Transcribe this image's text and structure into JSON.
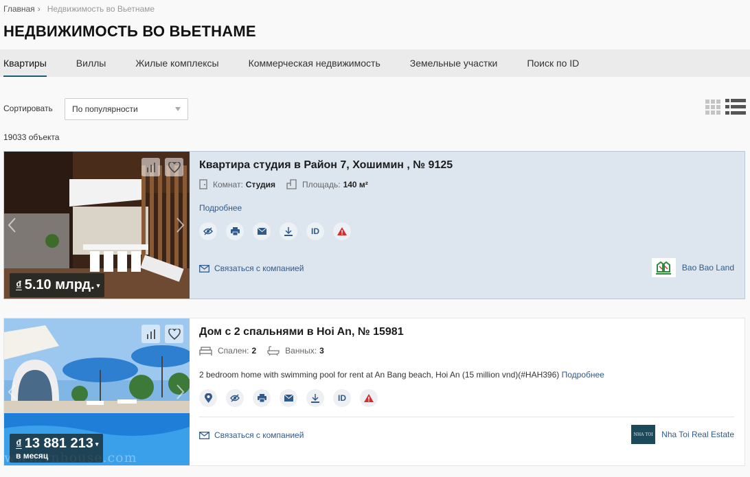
{
  "breadcrumb": {
    "home": "Главная",
    "separator": "›",
    "current": "Недвижимость во Вьетнаме"
  },
  "page_title": "НЕДВИЖИМОСТЬ ВО ВЬЕТНАМЕ",
  "tabs": [
    {
      "label": "Квартиры",
      "active": true
    },
    {
      "label": "Виллы"
    },
    {
      "label": "Жилые комплексы"
    },
    {
      "label": "Коммерческая недвижимость"
    },
    {
      "label": "Земельные участки"
    },
    {
      "label": "Поиск по ID"
    }
  ],
  "sort": {
    "label": "Сортировать",
    "value": "По популярности"
  },
  "results_count": "19033 объекта",
  "colors": {
    "link": "#2e5a8c",
    "highlight_bg": "#dde5ee",
    "alert": "#d32f2f",
    "tab_bar": "#ebebeb"
  },
  "listings": [
    {
      "title": "Квартира студия в Район 7, Хошимин , № 9125",
      "specs": [
        {
          "icon": "door-icon",
          "label": "Комнат:",
          "value": "Студия"
        },
        {
          "icon": "area-icon",
          "label": "Площадь:",
          "value": "140 м²"
        }
      ],
      "more_label": "Подробнее",
      "price": {
        "currency": "₫",
        "amount": "5.10 млрд."
      },
      "contact_label": "Связаться с компанией",
      "company": {
        "name": "Bao Bao Land"
      }
    },
    {
      "title": "Дом с 2 спальнями в Hoi An, № 15981",
      "specs": [
        {
          "icon": "bed-icon",
          "label": "Спален:",
          "value": "2"
        },
        {
          "icon": "bath-icon",
          "label": "Ванных:",
          "value": "3"
        }
      ],
      "description": "2 bedroom home with swimming pool for rent at An Bang beach, Hoi An (15 million vnd)(#HAH396)",
      "more_label": "Подробнее",
      "price": {
        "currency": "₫",
        "amount": "13 881 213",
        "period": "в месяц"
      },
      "watermark": "www.vnhouse.com",
      "contact_label": "Связаться с компанией",
      "company": {
        "name": "Nha Toi Real Estate",
        "logo_text": "NHA TOI"
      }
    }
  ]
}
